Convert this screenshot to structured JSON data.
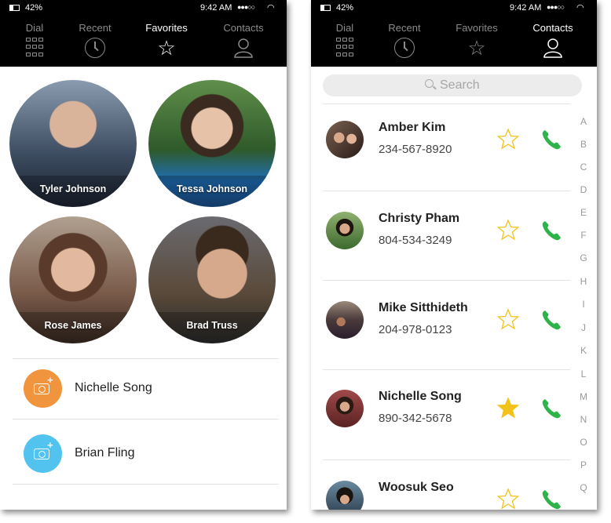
{
  "status": {
    "battery": "42%",
    "time": "9:42 AM",
    "signal": "●●●○○",
    "wifi": "wifi-icon"
  },
  "tabs": [
    {
      "label": "Dial",
      "icon": "dialpad-icon"
    },
    {
      "label": "Recent",
      "icon": "clock-icon"
    },
    {
      "label": "Favorites",
      "icon": "star-icon"
    },
    {
      "label": "Contacts",
      "icon": "person-icon"
    }
  ],
  "left_screen": {
    "active_tab": "Favorites",
    "favorites": [
      {
        "name": "Tyler Johnson",
        "photo_color": "#3b4a5e"
      },
      {
        "name": "Tessa Johnson",
        "photo_color": "#2f5a2a"
      },
      {
        "name": "Rose James",
        "photo_color": "#7a5b4a"
      },
      {
        "name": "Brad Truss",
        "photo_color": "#5a4a3a"
      }
    ],
    "list": [
      {
        "name": "Nichelle Song",
        "avatar_color": "#f0943e"
      },
      {
        "name": "Brian Fling",
        "avatar_color": "#52c3ef"
      }
    ]
  },
  "right_screen": {
    "active_tab": "Contacts",
    "search_placeholder": "Search",
    "contacts": [
      {
        "name": "Amber Kim",
        "phone": "234-567-8920",
        "favorite": false
      },
      {
        "name": "Christy Pham",
        "phone": "804-534-3249",
        "favorite": false
      },
      {
        "name": "Mike Sitthideth",
        "phone": "204-978-0123",
        "favorite": false
      },
      {
        "name": "Nichelle Song",
        "phone": "890-342-5678",
        "favorite": true
      },
      {
        "name": "Woosuk Seo",
        "phone": "",
        "favorite": false
      }
    ],
    "alphabet": [
      "A",
      "B",
      "C",
      "D",
      "E",
      "F",
      "G",
      "H",
      "I",
      "J",
      "K",
      "L",
      "M",
      "N",
      "O",
      "P",
      "Q"
    ]
  },
  "colors": {
    "topbar": "#000000",
    "star": "#f2c21b",
    "call": "#2eb34a",
    "text": "#222222"
  }
}
